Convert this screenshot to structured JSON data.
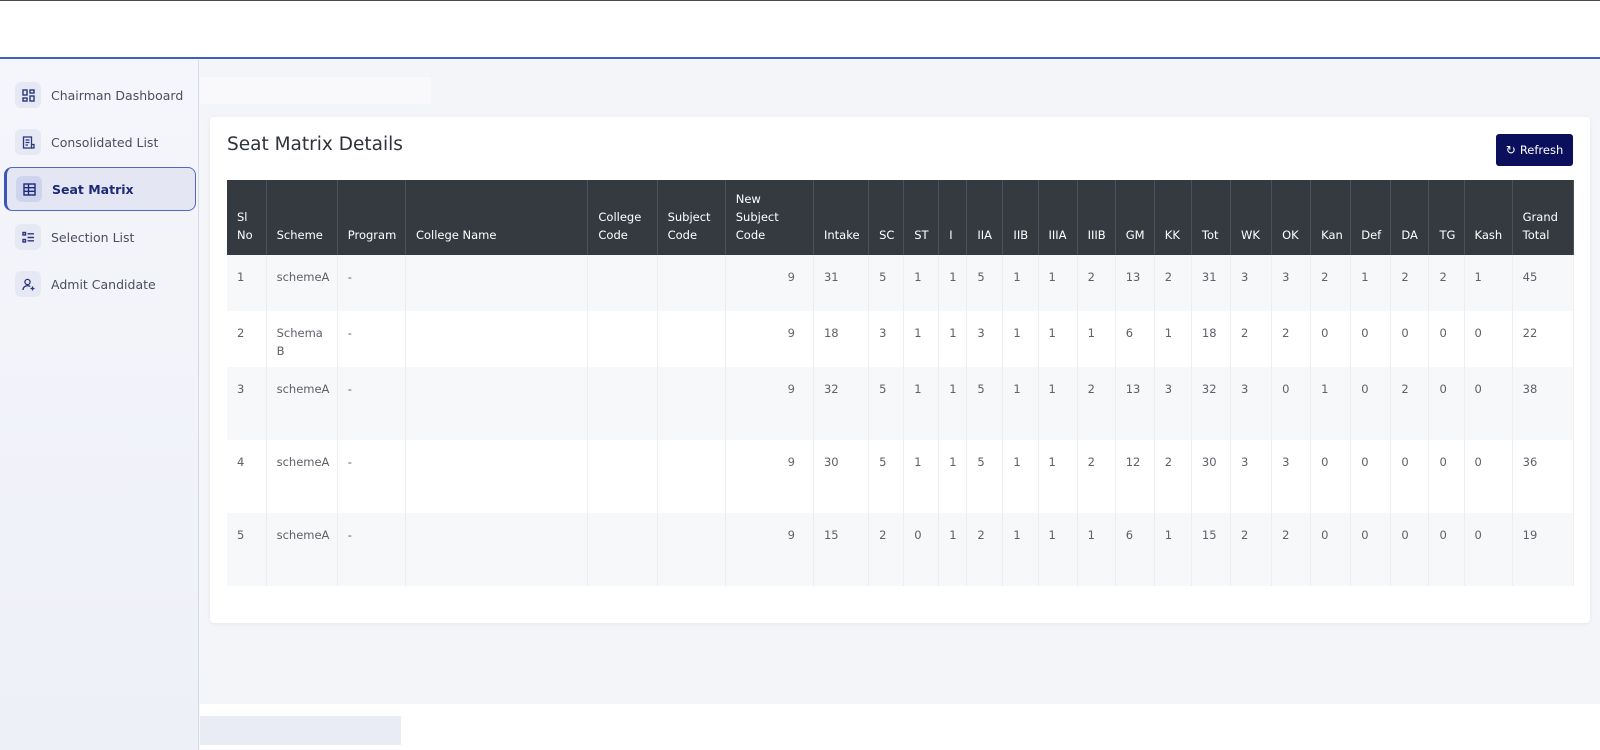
{
  "sidebar": {
    "items": [
      {
        "label": "Chairman Dashboard",
        "icon": "dashboard-icon",
        "active": false
      },
      {
        "label": "Consolidated List",
        "icon": "list-icon",
        "active": false
      },
      {
        "label": "Seat Matrix",
        "icon": "table-icon",
        "active": true
      },
      {
        "label": "Selection List",
        "icon": "checklist-icon",
        "active": false
      },
      {
        "label": "Admit Candidate",
        "icon": "user-add-icon",
        "active": false
      }
    ]
  },
  "main": {
    "title": "Seat Matrix Details",
    "refresh_label": "Refresh",
    "refresh_icon": "refresh-icon"
  },
  "table": {
    "headers": [
      "Sl No",
      "Scheme",
      "Program",
      "College Name",
      "College Code",
      "Subject Code",
      "New Subject Code",
      "Intake",
      "SC",
      "ST",
      "I",
      "IIA",
      "IIB",
      "IIIA",
      "IIIB",
      "GM",
      "KK",
      "Tot",
      "WK",
      "OK",
      "Kan",
      "Def",
      "DA",
      "TG",
      "Kash",
      "Grand Total"
    ],
    "rows": [
      [
        "1",
        "schemeA",
        "-",
        "",
        "",
        "",
        "9",
        "31",
        "5",
        "1",
        "1",
        "5",
        "1",
        "1",
        "2",
        "13",
        "2",
        "31",
        "3",
        "3",
        "2",
        "1",
        "2",
        "2",
        "1",
        "45"
      ],
      [
        "2",
        "Schema B",
        "-",
        "",
        "",
        "",
        "9",
        "18",
        "3",
        "1",
        "1",
        "3",
        "1",
        "1",
        "1",
        "6",
        "1",
        "18",
        "2",
        "2",
        "0",
        "0",
        "0",
        "0",
        "0",
        "22"
      ],
      [
        "3",
        "schemeA",
        "-",
        "",
        "",
        "",
        "9",
        "32",
        "5",
        "1",
        "1",
        "5",
        "1",
        "1",
        "2",
        "13",
        "3",
        "32",
        "3",
        "0",
        "1",
        "0",
        "2",
        "0",
        "0",
        "38"
      ],
      [
        "4",
        "schemeA",
        "-",
        "",
        "",
        "",
        "9",
        "30",
        "5",
        "1",
        "1",
        "5",
        "1",
        "1",
        "2",
        "12",
        "2",
        "30",
        "3",
        "3",
        "0",
        "0",
        "0",
        "0",
        "0",
        "36"
      ],
      [
        "5",
        "schemeA",
        "-",
        "",
        "",
        "",
        "9",
        "15",
        "2",
        "0",
        "1",
        "2",
        "1",
        "1",
        "1",
        "6",
        "1",
        "15",
        "2",
        "2",
        "0",
        "0",
        "0",
        "0",
        "0",
        "19"
      ]
    ]
  },
  "colors": {
    "accent": "#0b0f5c",
    "table_header": "#343a40",
    "active_nav_border": "#3b54b5"
  }
}
